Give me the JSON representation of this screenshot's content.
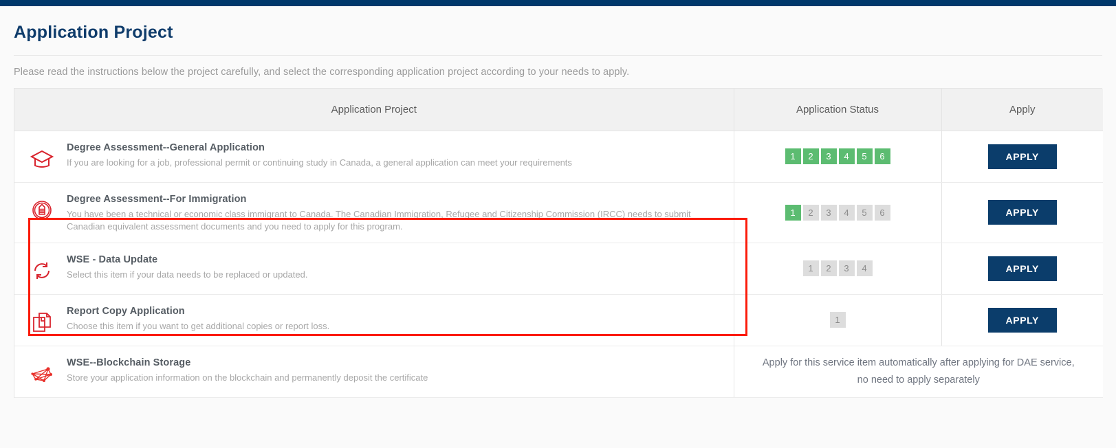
{
  "header": {
    "title": "Application Project",
    "intro": "Please read the instructions below the project carefully, and select the corresponding application project according to your needs to apply."
  },
  "table": {
    "columns": {
      "project": "Application Project",
      "status": "Application Status",
      "apply": "Apply"
    },
    "rows": [
      {
        "icon": "graduation-cap-icon",
        "title": "Degree Assessment--General Application",
        "desc": "If you are looking for a job, professional permit or continuing study in Canada, a general application can meet your requirements",
        "steps": [
          "1",
          "2",
          "3",
          "4",
          "5",
          "6"
        ],
        "steps_done": 6,
        "apply_label": "APPLY"
      },
      {
        "icon": "official-seal-icon",
        "title": "Degree Assessment--For Immigration",
        "desc": "You have been a technical or economic class immigrant to Canada. The Canadian Immigration, Refugee and Citizenship Commission (IRCC) needs to submit Canadian equivalent assessment documents and you need to apply for this program.",
        "steps": [
          "1",
          "2",
          "3",
          "4",
          "5",
          "6"
        ],
        "steps_done": 1,
        "apply_label": "APPLY"
      },
      {
        "icon": "refresh-sync-icon",
        "title": "WSE - Data Update",
        "desc": "Select this item if your data needs to be replaced or updated.",
        "steps": [
          "1",
          "2",
          "3",
          "4"
        ],
        "steps_done": 0,
        "apply_label": "APPLY"
      },
      {
        "icon": "copy-documents-icon",
        "title": "Report Copy Application",
        "desc": "Choose this item if you want to get additional copies or report loss.",
        "steps": [
          "1"
        ],
        "steps_done": 0,
        "apply_label": "APPLY"
      },
      {
        "icon": "blockchain-network-icon",
        "title": "WSE--Blockchain Storage",
        "desc": "Store your application information on the blockchain and permanently deposit the certificate",
        "note": "Apply for this service item automatically after applying for DAE service, no need to apply separately"
      }
    ]
  },
  "colors": {
    "topbar": "#00386b",
    "title": "#0f3c6b",
    "accent_red": "#d9232d",
    "step_done": "#5cbc71",
    "step_pending": "#dddddd",
    "apply_button": "#0b3d6b",
    "highlight_outline": "#fb1b0a"
  }
}
